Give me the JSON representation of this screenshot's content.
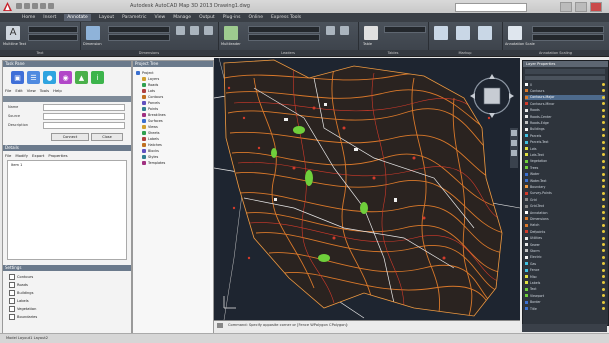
{
  "colors": {
    "ribbon_bg": "#3f454d",
    "canvas_bg": "#1e2530",
    "contour_orange": "#d9782a",
    "contour_red": "#d23a2a",
    "vegetation_green": "#6fcf3b",
    "road_white": "#e8e8e8"
  },
  "title": {
    "text": "Autodesk AutoCAD Map 3D 2013  Drawing1.dwg"
  },
  "ribbon": {
    "tabs": [
      "Home",
      "Insert",
      "Annotate",
      "Layout",
      "Parametric",
      "View",
      "Manage",
      "Output",
      "Plug-ins",
      "Online",
      "Express Tools"
    ],
    "active_tab": "Annotate",
    "panels": [
      "Text",
      "Dimensions",
      "Leaders",
      "Tables",
      "Markup",
      "Annotation Scaling"
    ],
    "panel_labels": {
      "text": "Multiline Text",
      "dimension": "Dimension",
      "leader": "Multileader",
      "table": "Table",
      "scale": "Annotation Scale"
    }
  },
  "left_palette": {
    "title": "Task Pane",
    "menu": [
      "File",
      "Edit",
      "View",
      "Tools",
      "Help"
    ],
    "icons": [
      "map-icon",
      "layers-icon",
      "globe-icon",
      "database-icon",
      "survey-icon",
      "info-icon"
    ],
    "fields": [
      {
        "label": "Name"
      },
      {
        "label": "Source"
      },
      {
        "label": "Description"
      }
    ],
    "buttons": [
      "Connect",
      "Close"
    ],
    "section2_title": "Details",
    "section2_menu": [
      "File",
      "Modify",
      "Export",
      "Properties"
    ],
    "list_first_item": "Item 1",
    "section3_title": "Settings",
    "checks": [
      "Contours",
      "Roads",
      "Buildings",
      "Labels",
      "Vegetation",
      "Boundaries"
    ]
  },
  "tree_palette": {
    "title": "Project Tree",
    "items": [
      "Project",
      "Layers",
      "Roads",
      "Lots",
      "Contours",
      "Parcels",
      "Points",
      "Breaklines",
      "Surfaces",
      "Views",
      "Sheets",
      "Labels",
      "Hatches",
      "Blocks",
      "Styles",
      "Templates"
    ]
  },
  "right_palette": {
    "title": "Layer Properties",
    "layers": [
      "0",
      "Contours",
      "Contours-Major",
      "Contours-Minor",
      "Roads",
      "Roads-Center",
      "Roads-Edge",
      "Buildings",
      "Parcels",
      "Parcels-Text",
      "Lots",
      "Lots-Text",
      "Vegetation",
      "Trees",
      "Water",
      "Water-Text",
      "Boundary",
      "Survey-Points",
      "Grid",
      "Grid-Text",
      "Annotation",
      "Dimensions",
      "Hatch",
      "Defpoints",
      "Utilities",
      "Sewer",
      "Storm",
      "Electric",
      "Gas",
      "Fence",
      "Misc",
      "Labels",
      "Text",
      "Viewport",
      "Border",
      "Title"
    ],
    "selected_index": 2
  },
  "command_line": {
    "text": "Command: Specify opposite corner or [Fence WPolygon CPolygon]:"
  },
  "status_bar": {
    "text": "Model  Layout1  Layout2"
  }
}
